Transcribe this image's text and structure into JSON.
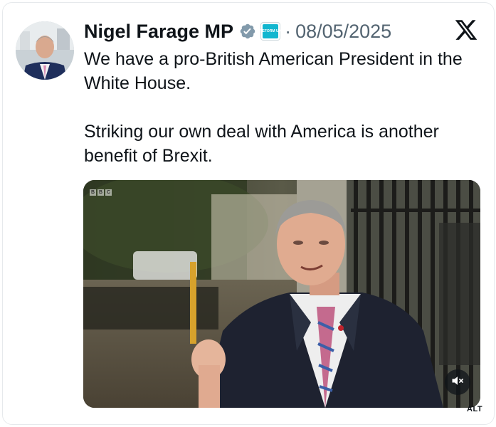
{
  "post": {
    "author_name": "Nigel Farage MP",
    "separator": "·",
    "date": "08/05/2025",
    "affiliate_badge_text": "REFORM UK",
    "paragraphs": [
      "We have a pro-British American President in the White House.",
      "Striking our own deal with America is another benefit of Brexit."
    ]
  },
  "media": {
    "watermark_letters": [
      "B",
      "B",
      "C"
    ],
    "alt_badge": "ALT"
  },
  "icons": {
    "verified": "verified-badge-icon",
    "affiliate": "reform-uk-affiliate-icon",
    "platform": "x-logo-icon",
    "mute": "volume-muted-icon"
  },
  "colors": {
    "verified_badge": "#829aab",
    "affiliate_badge": "#12b6cf",
    "secondary_text": "#536471",
    "primary_text": "#0f1419"
  }
}
